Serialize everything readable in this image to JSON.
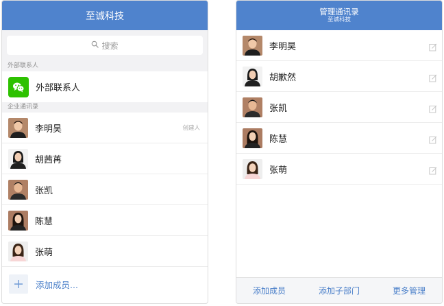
{
  "left_panel": {
    "header": {
      "title": "至诚科技"
    },
    "search": {
      "placeholder": "搜索"
    },
    "external": {
      "section_label": "外部联系人",
      "item_label": "外部联系人"
    },
    "enterprise": {
      "section_label": "企业通讯录",
      "members": [
        {
          "name": "李明昊",
          "tag": "创建人"
        },
        {
          "name": "胡茜苒"
        },
        {
          "name": "张凯"
        },
        {
          "name": "陈慧"
        },
        {
          "name": "张萌"
        }
      ]
    },
    "add_member_label": "添加成员..."
  },
  "right_panel": {
    "header": {
      "title": "管理通讯录",
      "subtitle": "至诚科技"
    },
    "members": [
      {
        "name": "李明昊"
      },
      {
        "name": "胡歉然"
      },
      {
        "name": "张凯"
      },
      {
        "name": "陈慧"
      },
      {
        "name": "张萌"
      }
    ],
    "footer": {
      "add_member": "添加成员",
      "add_sub_department": "添加子部门",
      "more_management": "更多管理"
    }
  },
  "colors": {
    "header_bg": "#4f83cd",
    "link": "#4a7fc9",
    "wechat_green": "#2dc100",
    "section_bg": "#f2f2f4"
  },
  "icons": {
    "search": "search-icon",
    "wechat": "wechat-icon",
    "add": "plus-icon",
    "edit": "edit-icon"
  }
}
